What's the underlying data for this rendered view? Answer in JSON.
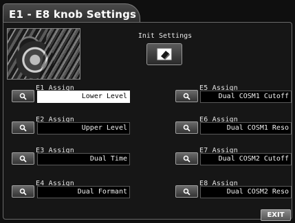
{
  "window": {
    "title": "E1 - E8 knob Settings"
  },
  "init": {
    "label": "Init Settings",
    "icon": "eraser-icon"
  },
  "assigns": [
    {
      "label": "E1 Assign",
      "value": "Lower Level",
      "active": true
    },
    {
      "label": "E2 Assign",
      "value": "Upper Level",
      "active": false
    },
    {
      "label": "E3 Assign",
      "value": "Dual Time",
      "active": false
    },
    {
      "label": "E4 Assign",
      "value": "Dual Formant",
      "active": false
    },
    {
      "label": "E5 Assign",
      "value": "Dual COSM1 Cutoff",
      "active": false
    },
    {
      "label": "E6 Assign",
      "value": "Dual COSM1 Reso",
      "active": false
    },
    {
      "label": "E7 Assign",
      "value": "Dual COSM2 Cutoff",
      "active": false
    },
    {
      "label": "E8 Assign",
      "value": "Dual COSM2 Reso",
      "active": false
    }
  ],
  "footer": {
    "exit_label": "EXIT"
  },
  "colors": {
    "background": "#101010",
    "active_field": "#ffffff",
    "text": "#e8e8e8"
  }
}
